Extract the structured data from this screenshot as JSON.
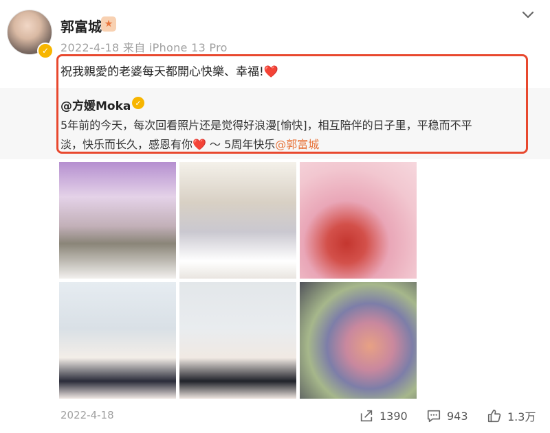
{
  "user": {
    "name": "郭富城",
    "avatar_icon": "avatar-photo",
    "verified_icon": "verified-v-icon",
    "badge_icon": "star-badge-icon"
  },
  "meta": {
    "date": "2022-4-18",
    "source": "来自 iPhone 13 Pro"
  },
  "post": {
    "text": "祝我親愛的老婆每天都開心快樂、幸福!",
    "heart": "❤️"
  },
  "repost": {
    "user": "@方媛Moka",
    "line1": "5年前的今天，每次回看照片还是觉得好浪漫[愉快]，相互陪伴的日子里，平稳而不平",
    "line2_prefix": "淡，快乐而长久，感恩有你",
    "heart": "❤️",
    "line2_suffix": " ～ 5周年快乐",
    "mention": "@郭富城"
  },
  "photos": [
    {
      "icon": "wedding-photo-1"
    },
    {
      "icon": "wedding-photo-2"
    },
    {
      "icon": "wedding-photo-3"
    },
    {
      "icon": "wedding-photo-4"
    },
    {
      "icon": "wedding-photo-5"
    },
    {
      "icon": "wedding-photo-6"
    }
  ],
  "footer": {
    "date": "2022-4-18",
    "shares": "1390",
    "comments": "943",
    "likes": "1.3万"
  },
  "colors": {
    "highlight_border": "#e8482e",
    "mention": "#e8743b",
    "verified": "#f7b500",
    "heart": "#e8302a"
  }
}
